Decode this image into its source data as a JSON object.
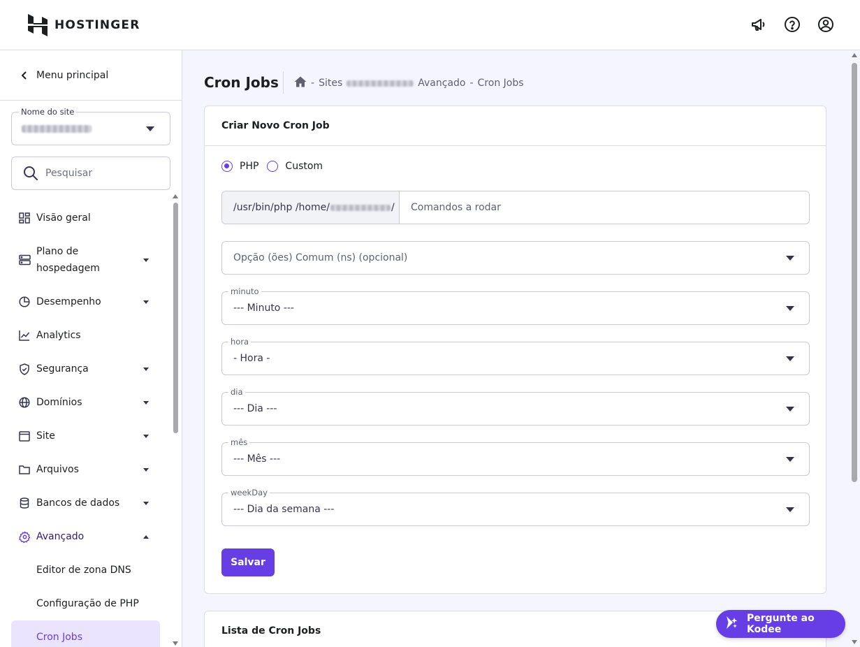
{
  "brand": {
    "name": "HOSTINGER",
    "accent": "#673de6",
    "icon": "hostinger-logo-icon"
  },
  "header": {
    "icons": [
      "megaphone-icon",
      "help-icon",
      "account-icon"
    ]
  },
  "sidebar": {
    "back_label": "Menu principal",
    "site_field": {
      "label": "Nome do site",
      "value": ""
    },
    "search": {
      "placeholder": "Pesquisar"
    },
    "items": [
      {
        "label": "Visão geral",
        "icon": "overview-icon",
        "expandable": false
      },
      {
        "label": "Plano de hospedagem",
        "icon": "server-icon",
        "expandable": true
      },
      {
        "label": "Desempenho",
        "icon": "performance-icon",
        "expandable": true
      },
      {
        "label": "Analytics",
        "icon": "analytics-icon",
        "expandable": false
      },
      {
        "label": "Segurança",
        "icon": "shield-icon",
        "expandable": true
      },
      {
        "label": "Domínios",
        "icon": "globe-icon",
        "expandable": true
      },
      {
        "label": "Site",
        "icon": "browser-window-icon",
        "expandable": true
      },
      {
        "label": "Arquivos",
        "icon": "folder-icon",
        "expandable": true
      },
      {
        "label": "Bancos de dados",
        "icon": "database-icon",
        "expandable": true
      },
      {
        "label": "Avançado",
        "icon": "gear-icon",
        "expandable": true,
        "expanded": true
      }
    ],
    "sub_items": [
      {
        "label": "Editor de zona DNS",
        "selected": false
      },
      {
        "label": "Configuração de PHP",
        "selected": false
      },
      {
        "label": "Cron Jobs",
        "selected": true
      }
    ]
  },
  "main": {
    "title": "Cron Jobs",
    "breadcrumb": {
      "home_icon": "home-icon",
      "items": [
        "Sites",
        "Avançado",
        "Cron Jobs"
      ],
      "separator": "-"
    },
    "create_card": {
      "title": "Criar Novo Cron Job",
      "radios": [
        {
          "label": "PHP",
          "checked": true
        },
        {
          "label": "Custom",
          "checked": false
        }
      ],
      "command": {
        "prefix_start": "/usr/bin/php /home/",
        "prefix_end": "/",
        "placeholder": "Comandos a rodar"
      },
      "common_options": {
        "placeholder": "Opção (ões) Comum (ns) (opcional)"
      },
      "selects": [
        {
          "label": "minuto",
          "value": "--- Minuto ---"
        },
        {
          "label": "hora",
          "value": "- Hora -"
        },
        {
          "label": "dia",
          "value": "--- Dia ---"
        },
        {
          "label": "mês",
          "value": "--- Mês ---"
        },
        {
          "label": "weekDay",
          "value": "--- Dia da semana ---"
        }
      ],
      "save_label": "Salvar"
    },
    "list_card": {
      "title": "Lista de Cron Jobs"
    }
  },
  "kodee": {
    "label": "Pergunte ao Kodee",
    "icon": "kodee-sparkle-icon"
  }
}
